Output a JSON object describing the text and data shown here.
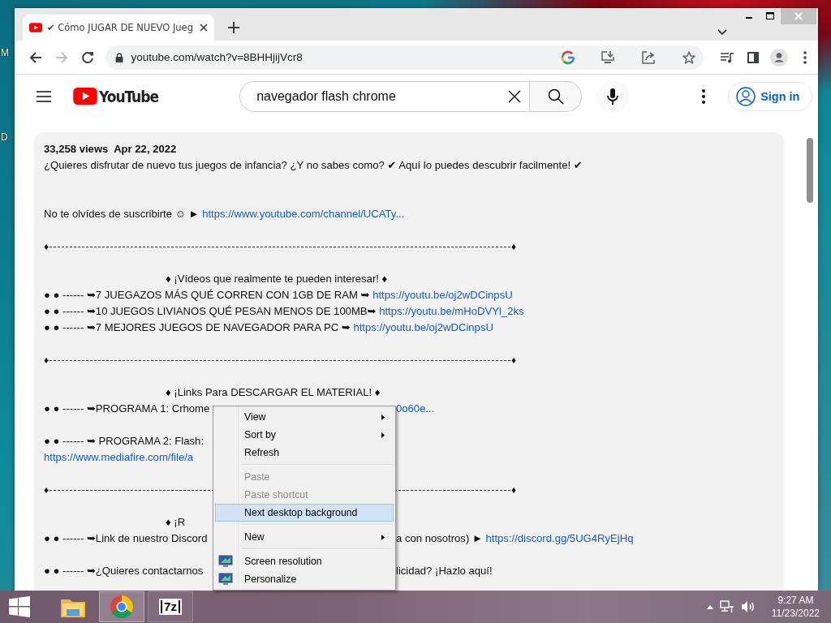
{
  "desktop": {
    "icon_labels": [
      "M",
      "D"
    ]
  },
  "browser": {
    "tabs": [
      {
        "title": "✔ Cómo JUGAR DE NUEVO Jueg",
        "selected": true
      }
    ],
    "address": "youtube.com/watch?v=8BHHjijVcr8",
    "forward_disabled": true
  },
  "youtube": {
    "logo_text": "YouTube",
    "search": {
      "value": "navegador flash chrome"
    },
    "sign_in": "Sign in"
  },
  "description": {
    "meta": "33,258 views  Apr 22, 2022",
    "lines": [
      {
        "kind": "text",
        "parts": [
          {
            "text": "¿Quieres disfrutar de nuevo tus juegos de infancia? ¿Y no sabes como? ✔ Aquí lo puedes descubrir facilmente! ✔",
            "link": false
          }
        ]
      },
      {
        "kind": "blank"
      },
      {
        "kind": "blank"
      },
      {
        "kind": "text",
        "parts": [
          {
            "text": "No te olvídes de suscribirte ☺ ► ",
            "link": false
          },
          {
            "text": "https://www.youtube.com/channel/UCATy...",
            "link": true
          }
        ]
      },
      {
        "kind": "blank"
      },
      {
        "kind": "separator",
        "left": "♦",
        "right": "♦"
      },
      {
        "kind": "blank"
      },
      {
        "kind": "heading",
        "parts": [
          {
            "text": "♦ ¡Vídeos que realmente te pueden interesar! ♦",
            "link": false
          }
        ]
      },
      {
        "kind": "text",
        "parts": [
          {
            "text": "● ● ------ ➥7 JUEGAZOS MÁS QUÉ CORREN CON 1GB DE RAM ➥ ",
            "link": false
          },
          {
            "text": "https://youtu.be/oj2wDCinpsU",
            "link": true
          }
        ]
      },
      {
        "kind": "text",
        "parts": [
          {
            "text": "● ● ------ ➥10 JUEGOS LIVIANOS QUÉ PESAN MENOS DE 100MB➥ ",
            "link": false
          },
          {
            "text": "https://youtu.be/mHoDVYl_2ks",
            "link": true
          }
        ]
      },
      {
        "kind": "text",
        "parts": [
          {
            "text": "● ● ------ ➥7 MEJORES JUEGOS DE NAVEGADOR PARA PC ➥ ",
            "link": false
          },
          {
            "text": "https://youtu.be/oj2wDCinpsU",
            "link": true
          }
        ]
      },
      {
        "kind": "blank"
      },
      {
        "kind": "separator",
        "left": "♦",
        "right": "♦"
      },
      {
        "kind": "blank"
      },
      {
        "kind": "heading",
        "parts": [
          {
            "text": "♦ ¡Links Para DESCARGAR EL MATERIAL! ♦",
            "link": false
          }
        ]
      },
      {
        "kind": "text",
        "parts": [
          {
            "text": "● ● ------ ➥PROGRAMA 1: Crhome",
            "link": false
          }
        ],
        "right": [
          {
            "text": "0o60e...",
            "link": true
          }
        ]
      },
      {
        "kind": "blank"
      },
      {
        "kind": "text",
        "parts": [
          {
            "text": "● ● ------ ➥ PROGRAMA 2: Flash:",
            "link": false
          }
        ]
      },
      {
        "kind": "text",
        "parts": [
          {
            "text": "https://www.mediafire.com/file/a",
            "link": true
          }
        ]
      },
      {
        "kind": "blank"
      },
      {
        "kind": "separator",
        "left": "♦",
        "right": "♦"
      },
      {
        "kind": "blank"
      },
      {
        "kind": "heading",
        "parts": [
          {
            "text": "♦ ¡R",
            "link": false
          }
        ]
      },
      {
        "kind": "text",
        "parts": [
          {
            "text": "● ● ------ ➥Link de nuestro Discord",
            "link": false
          }
        ],
        "right": [
          {
            "text": "a con nosotros) ► ",
            "link": false
          },
          {
            "text": "https://discord.gg/5UG4RyEjHq",
            "link": true
          }
        ]
      },
      {
        "kind": "blank"
      },
      {
        "kind": "text",
        "parts": [
          {
            "text": "● ● ------ ➥¿Quieres contactarnos",
            "link": false
          }
        ],
        "right": [
          {
            "text": "licidad? ¡Hazlo aquí!",
            "link": false
          }
        ]
      }
    ]
  },
  "context_menu": {
    "items": [
      {
        "kind": "item",
        "label": "View",
        "submenu": true,
        "disabled": false,
        "selected": false
      },
      {
        "kind": "item",
        "label": "Sort by",
        "submenu": true,
        "disabled": false,
        "selected": false
      },
      {
        "kind": "item",
        "label": "Refresh",
        "submenu": false,
        "disabled": false,
        "selected": false
      },
      {
        "kind": "separator"
      },
      {
        "kind": "item",
        "label": "Paste",
        "submenu": false,
        "disabled": true,
        "selected": false
      },
      {
        "kind": "item",
        "label": "Paste shortcut",
        "submenu": false,
        "disabled": true,
        "selected": false
      },
      {
        "kind": "item",
        "label": "Next desktop background",
        "submenu": false,
        "disabled": false,
        "selected": true
      },
      {
        "kind": "separator"
      },
      {
        "kind": "item",
        "label": "New",
        "submenu": true,
        "disabled": false,
        "selected": false
      },
      {
        "kind": "separator"
      },
      {
        "kind": "icon_item",
        "label": "Screen resolution",
        "submenu": false,
        "disabled": false,
        "selected": false
      },
      {
        "kind": "icon_item",
        "label": "Personalize",
        "submenu": false,
        "disabled": false,
        "selected": false
      }
    ]
  },
  "taskbar": {
    "items": [
      {
        "kind": "folder",
        "selected": false
      },
      {
        "kind": "browser",
        "selected": true
      },
      {
        "kind": "archiver",
        "label": "7z",
        "selected": false
      }
    ],
    "clock": {
      "time": "9:27 AM",
      "date": "11/23/2022"
    }
  }
}
